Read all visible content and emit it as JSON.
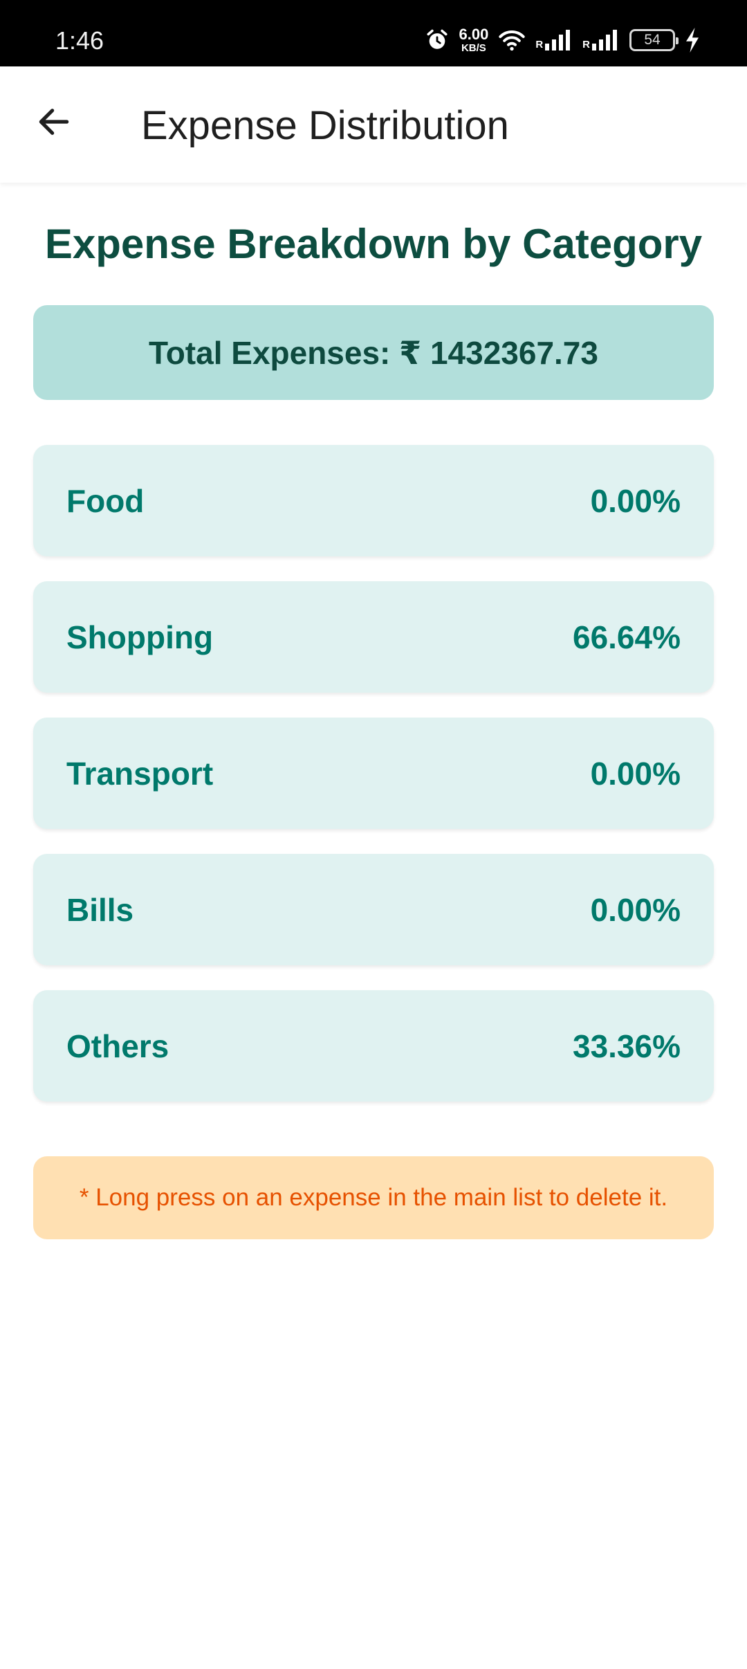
{
  "status_bar": {
    "time": "1:46",
    "net_speed_value": "6.00",
    "net_speed_unit": "KB/S",
    "signal_label_1": "R",
    "signal_label_2": "R",
    "battery_level": "54",
    "icons": [
      "alarm-icon",
      "wifi-icon",
      "signal-icon",
      "signal-icon",
      "battery-icon",
      "charging-bolt-icon"
    ]
  },
  "app_bar": {
    "back_icon": "arrow-left-icon",
    "title": "Expense Distribution"
  },
  "heading": "Expense Breakdown by Category",
  "total": {
    "text": "Total Expenses: ₹ 1432367.73"
  },
  "categories": [
    {
      "name": "Food",
      "percent": "0.00%"
    },
    {
      "name": "Shopping",
      "percent": "66.64%"
    },
    {
      "name": "Transport",
      "percent": "0.00%"
    },
    {
      "name": "Bills",
      "percent": "0.00%"
    },
    {
      "name": "Others",
      "percent": "33.36%"
    }
  ],
  "tip": "* Long press on an expense in the main list to delete it.",
  "colors": {
    "heading": "#0d4d40",
    "total_card_bg": "#b2dfdb",
    "category_card_bg": "#e0f2f1",
    "category_text": "#00796b",
    "tip_bg": "#ffe0b2",
    "tip_text": "#e65100"
  }
}
